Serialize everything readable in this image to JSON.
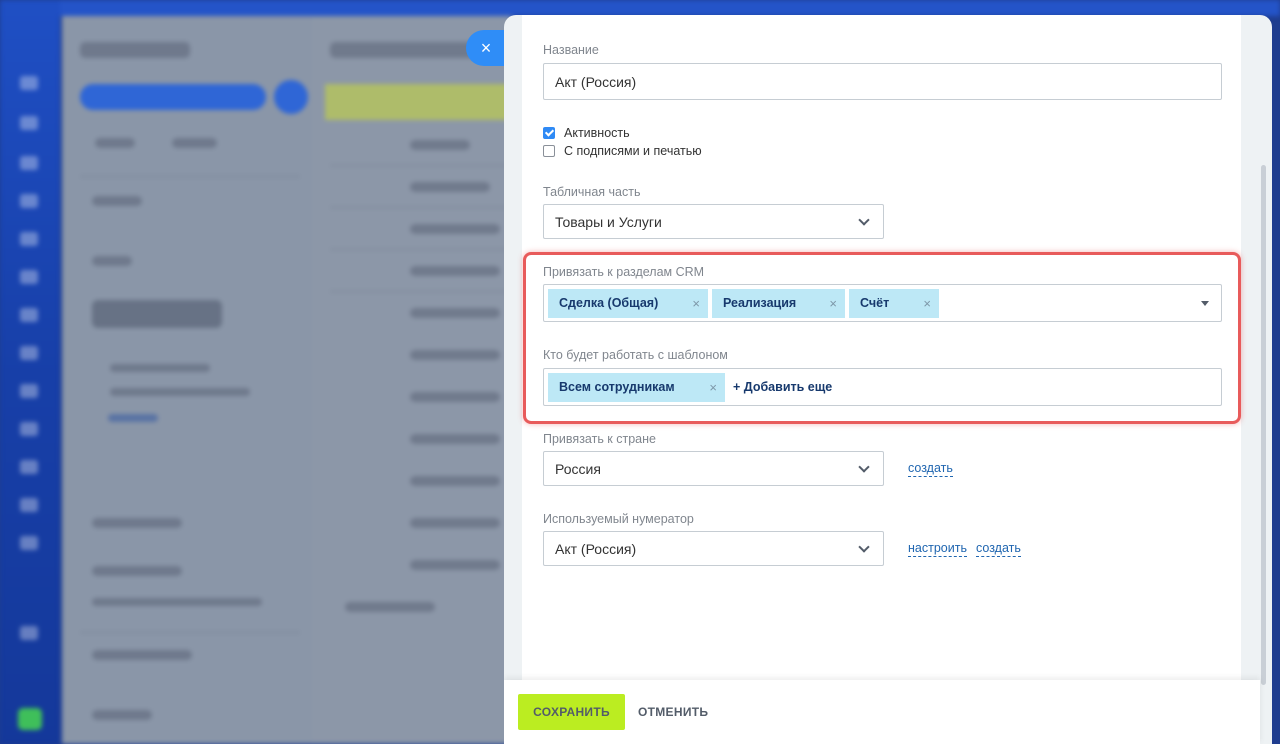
{
  "close_icon": "×",
  "form": {
    "name_label": "Название",
    "name_value": "Акт (Россия)",
    "active_label": "Активность",
    "active_checked": true,
    "signatures_label": "С подписями и печатью",
    "signatures_checked": false,
    "table_part_label": "Табличная часть",
    "table_part_value": "Товары и Услуги",
    "crm_label": "Привязать к разделам CRM",
    "crm_tags": [
      "Сделка (Общая)",
      "Реализация",
      "Счёт"
    ],
    "users_label": "Кто будет работать с шаблоном",
    "users_tags": [
      "Всем сотрудникам"
    ],
    "users_add_label": "+ Добавить еще",
    "tag_remove_icon": "×",
    "country_label": "Привязать к стране",
    "country_value": "Россия",
    "country_create_link": "создать",
    "numerator_label": "Используемый нумератор",
    "numerator_value": "Акт (Россия)",
    "numerator_configure_link": "настроить",
    "numerator_create_link": "создать"
  },
  "footer": {
    "save_label": "СОХРАНИТЬ",
    "cancel_label": "ОТМЕНИТЬ"
  },
  "colors": {
    "highlight": "#e85b5b",
    "save_button": "#bbed21",
    "tag_bg": "#bde8f6",
    "link": "#2066b0",
    "close_button": "#2f8df7"
  }
}
